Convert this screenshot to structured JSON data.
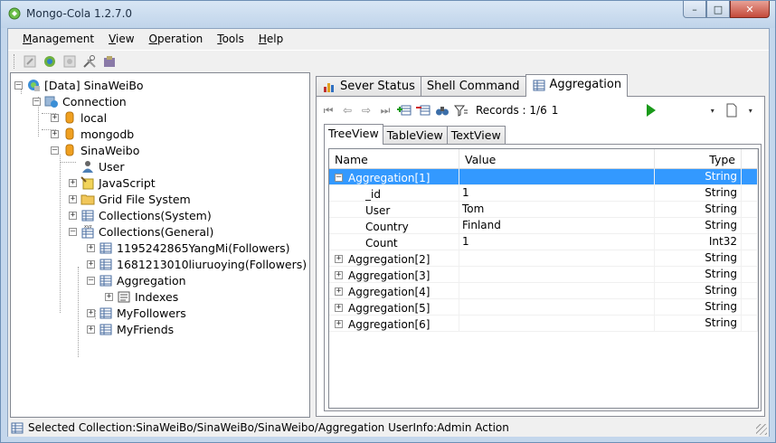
{
  "window": {
    "title": "Mongo-Cola  1.2.7.0",
    "caption": {
      "minimize": "–",
      "maximize": "□",
      "close": "✕"
    }
  },
  "menu": {
    "management": {
      "u": "M",
      "rest": "anagement"
    },
    "view": {
      "u": "V",
      "rest": "iew"
    },
    "operation": {
      "u": "O",
      "rest": "peration"
    },
    "tools": {
      "u": "T",
      "rest": "ools"
    },
    "help": {
      "u": "H",
      "rest": "elp"
    }
  },
  "tree": {
    "root": "[Data]  SinaWeiBo",
    "connection": "Connection",
    "local": "local",
    "mongodb": "mongodb",
    "sinaweibo": "SinaWeibo",
    "user": "User",
    "javascript": "JavaScript",
    "gridfs": "Grid File System",
    "collections_system": "Collections(System)",
    "collections_general": "Collections(General)",
    "coll1": "1195242865YangMi(Followers)",
    "coll2": "1681213010liuruoying(Followers)",
    "aggregation": "Aggregation",
    "indexes": "Indexes",
    "myfollowers": "MyFollowers",
    "myfriends": "MyFriends"
  },
  "tabs": {
    "server_status": "Sever Status",
    "shell_command": "Shell Command",
    "aggregation": "Aggregation"
  },
  "agg_toolbar": {
    "records_label": "Records : 1/6",
    "records_value": "1"
  },
  "subtabs": {
    "tree": "TreeView",
    "table": "TableView",
    "text": "TextView"
  },
  "grid": {
    "columns": {
      "name": "Name",
      "value": "Value",
      "type": "Type"
    },
    "rows": [
      {
        "name": "Aggregation[1]",
        "value": "",
        "type": "String"
      },
      {
        "name": "_id",
        "value": "1",
        "type": "String"
      },
      {
        "name": "User",
        "value": "Tom",
        "type": "String"
      },
      {
        "name": "Country",
        "value": "Finland",
        "type": "String"
      },
      {
        "name": "Count",
        "value": "1",
        "type": "Int32"
      },
      {
        "name": "Aggregation[2]",
        "value": "",
        "type": "String"
      },
      {
        "name": "Aggregation[3]",
        "value": "",
        "type": "String"
      },
      {
        "name": "Aggregation[4]",
        "value": "",
        "type": "String"
      },
      {
        "name": "Aggregation[5]",
        "value": "",
        "type": "String"
      },
      {
        "name": "Aggregation[6]",
        "value": "",
        "type": "String"
      }
    ]
  },
  "status": {
    "text": "Selected Collection:SinaWeiBo/SinaWeiBo/SinaWeibo/Aggregation  UserInfo:Admin  Action"
  },
  "colors": {
    "selection": "#3399ff",
    "play": "#1a9a1a",
    "db_icon": "#f0a020"
  }
}
